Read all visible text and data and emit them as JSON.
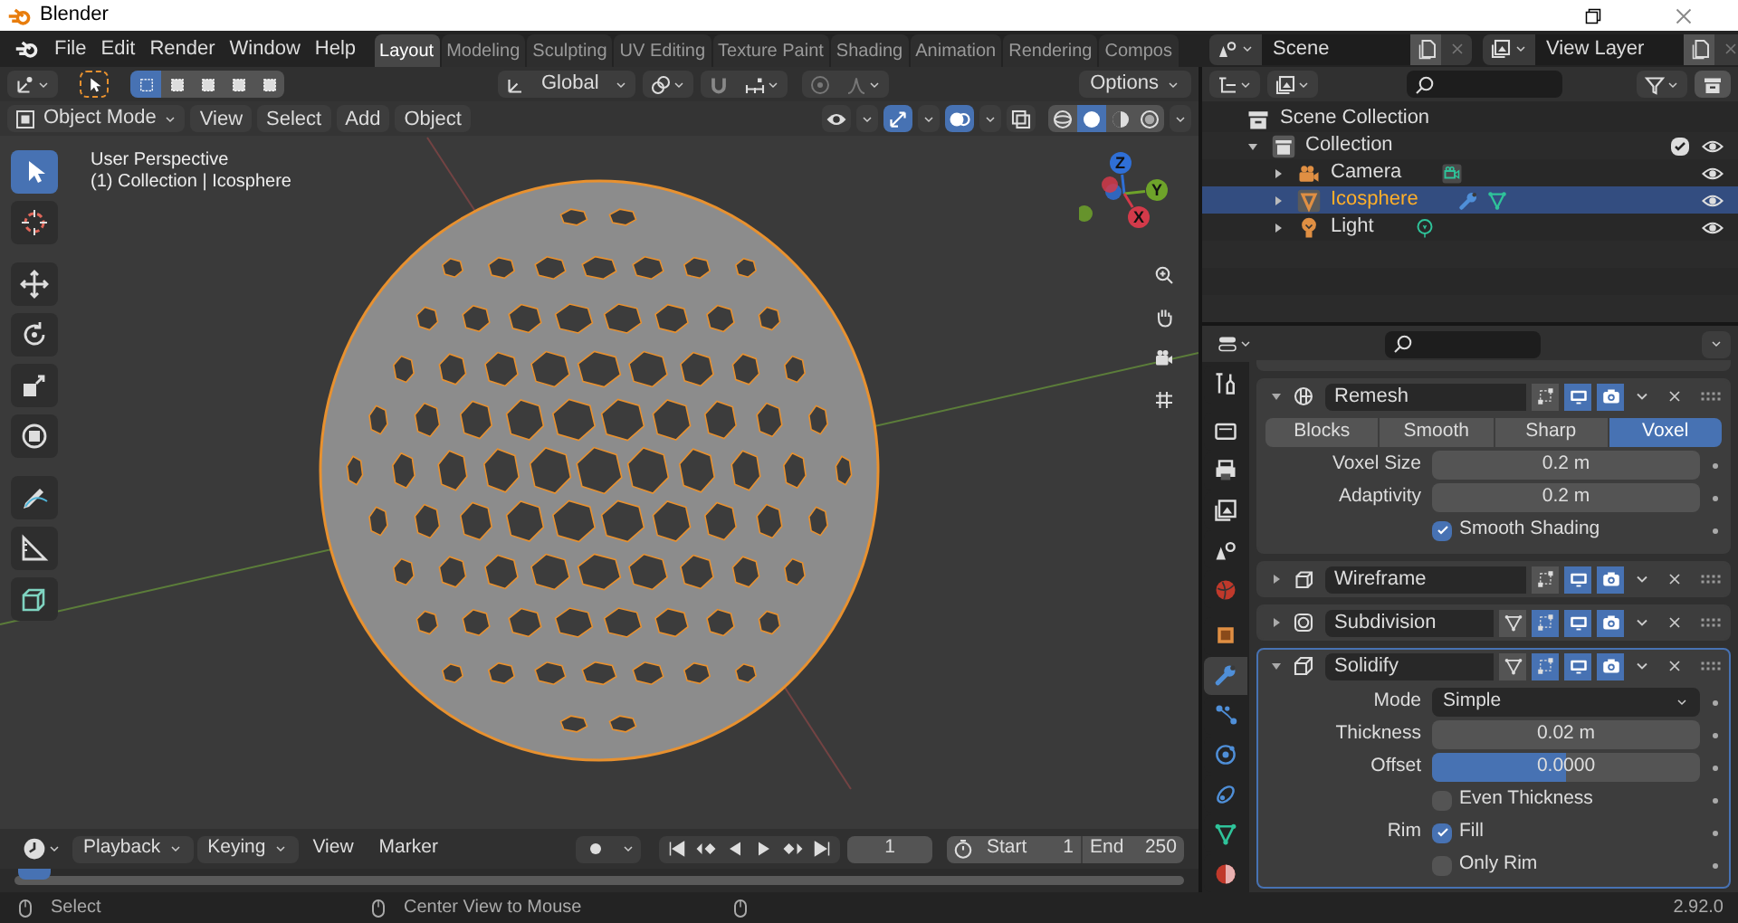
{
  "window": {
    "title": "Blender"
  },
  "menu": [
    "File",
    "Edit",
    "Render",
    "Window",
    "Help"
  ],
  "workspaces": [
    {
      "label": "Layout",
      "selected": true
    },
    {
      "label": "Modeling",
      "selected": false
    },
    {
      "label": "Sculpting",
      "selected": false
    },
    {
      "label": "UV Editing",
      "selected": false
    },
    {
      "label": "Texture Paint",
      "selected": false
    },
    {
      "label": "Shading",
      "selected": false
    },
    {
      "label": "Animation",
      "selected": false
    },
    {
      "label": "Rendering",
      "selected": false
    },
    {
      "label": "Compos",
      "selected": false
    }
  ],
  "scene": {
    "value": "Scene"
  },
  "view_layer": {
    "value": "View Layer"
  },
  "tool_header": {
    "select_modes": [
      {
        "selected": true
      },
      {
        "selected": false
      },
      {
        "selected": false
      },
      {
        "selected": false
      },
      {
        "selected": false
      }
    ],
    "orientation": "Global",
    "options": "Options"
  },
  "viewport_header": {
    "mode": "Object Mode",
    "menus": [
      "View",
      "Select",
      "Add",
      "Object"
    ],
    "toggles": [
      {
        "kind": "visibility",
        "on": false
      },
      {
        "kind": "gizmo",
        "on": true
      },
      {
        "kind": "overlay",
        "on": true
      },
      {
        "kind": "xray",
        "on": false
      }
    ],
    "shading": [
      {
        "kind": "wireframe",
        "selected": false
      },
      {
        "kind": "solid",
        "selected": true
      },
      {
        "kind": "material",
        "selected": false
      },
      {
        "kind": "rendered",
        "selected": false
      }
    ]
  },
  "viewport": {
    "perspective": "User Perspective",
    "context": "(1) Collection | Icosphere",
    "axes": [
      {
        "label": "Z",
        "color": "#2f6fd6"
      },
      {
        "label": "Y",
        "color": "#6ea32a"
      },
      {
        "label": "X",
        "color": "#d33a4a"
      }
    ]
  },
  "toolbar": [
    {
      "kind": "select",
      "selected": true
    },
    {
      "kind": "cursor",
      "selected": false
    },
    {
      "kind": "move",
      "selected": false
    },
    {
      "kind": "rotate",
      "selected": false
    },
    {
      "kind": "scale",
      "selected": false
    },
    {
      "kind": "transform",
      "selected": false
    },
    {
      "kind": "annotate",
      "selected": false
    },
    {
      "kind": "measure",
      "selected": false
    },
    {
      "kind": "add-cube",
      "selected": false
    }
  ],
  "outliner": {
    "items": [
      {
        "label": "Scene Collection",
        "kind": "scene-collection",
        "children": [
          {
            "label": "Collection",
            "kind": "collection",
            "expanded": true,
            "checked": true,
            "visible": true,
            "children": [
              {
                "label": "Camera",
                "kind": "camera",
                "expanded": false,
                "selected": false,
                "visible": true
              },
              {
                "label": "Icosphere",
                "kind": "mesh",
                "expanded": false,
                "selected": true,
                "visible": true
              },
              {
                "label": "Light",
                "kind": "light",
                "expanded": false,
                "selected": false,
                "visible": true
              }
            ]
          }
        ]
      }
    ]
  },
  "properties": {
    "tabs": [
      {
        "kind": "tool",
        "selected": false
      },
      {
        "kind": "render",
        "selected": false
      },
      {
        "kind": "output",
        "selected": false
      },
      {
        "kind": "view-layer",
        "selected": false
      },
      {
        "kind": "scene",
        "selected": false
      },
      {
        "kind": "world",
        "selected": false
      },
      {
        "kind": "object",
        "selected": false
      },
      {
        "kind": "modifier",
        "selected": true
      },
      {
        "kind": "particles",
        "selected": false
      },
      {
        "kind": "physics",
        "selected": false
      },
      {
        "kind": "constraints",
        "selected": false
      },
      {
        "kind": "data",
        "selected": false
      },
      {
        "kind": "material",
        "selected": false
      }
    ],
    "modifiers": [
      {
        "kind": "remesh",
        "name": "Remesh",
        "expanded": true,
        "active": false,
        "toggles": [
          {
            "kind": "editmode",
            "on": false
          },
          {
            "kind": "realtime",
            "on": true
          },
          {
            "kind": "render",
            "on": true
          }
        ],
        "rows": [
          {
            "kind": "segmented",
            "options": [
              {
                "label": "Blocks",
                "selected": false
              },
              {
                "label": "Smooth",
                "selected": false
              },
              {
                "label": "Sharp",
                "selected": false
              },
              {
                "label": "Voxel",
                "selected": true
              }
            ]
          },
          {
            "kind": "number",
            "label": "Voxel Size",
            "value": "0.2 m"
          },
          {
            "kind": "number",
            "label": "Adaptivity",
            "value": "0.2 m"
          },
          {
            "kind": "checkbox",
            "text": "Smooth Shading",
            "checked": true
          }
        ]
      },
      {
        "kind": "wireframe",
        "name": "Wireframe",
        "expanded": false,
        "active": false,
        "toggles": [
          {
            "kind": "editmode",
            "on": false
          },
          {
            "kind": "realtime",
            "on": true
          },
          {
            "kind": "render",
            "on": true
          }
        ]
      },
      {
        "kind": "subdivision",
        "name": "Subdivision",
        "expanded": false,
        "active": false,
        "toggles": [
          {
            "kind": "cage",
            "on": false
          },
          {
            "kind": "editmode",
            "on": true
          },
          {
            "kind": "realtime",
            "on": true
          },
          {
            "kind": "render",
            "on": true
          }
        ]
      },
      {
        "kind": "solidify",
        "name": "Solidify",
        "expanded": true,
        "active": true,
        "toggles": [
          {
            "kind": "cage",
            "on": false
          },
          {
            "kind": "editmode",
            "on": true
          },
          {
            "kind": "realtime",
            "on": true
          },
          {
            "kind": "render",
            "on": true
          }
        ],
        "rows": [
          {
            "kind": "dropdown",
            "label": "Mode",
            "value": "Simple"
          },
          {
            "kind": "number",
            "label": "Thickness",
            "value": "0.02 m"
          },
          {
            "kind": "slider",
            "label": "Offset",
            "value": "0.0000",
            "level": 0.5
          },
          {
            "kind": "checkbox",
            "text": "Even Thickness",
            "checked": false
          },
          {
            "kind": "checkbox",
            "label": "Rim",
            "text": "Fill",
            "checked": true
          },
          {
            "kind": "checkbox",
            "text": "Only Rim",
            "checked": false
          }
        ]
      }
    ]
  },
  "timeline": {
    "menus": [
      {
        "label": "Playback",
        "dropdown": true
      },
      {
        "label": "Keying",
        "dropdown": true
      },
      {
        "label": "View",
        "dropdown": false
      },
      {
        "label": "Marker",
        "dropdown": false
      }
    ],
    "current_frame": "1",
    "start_label": "Start",
    "start": "1",
    "end_label": "End",
    "end": "250"
  },
  "status_bar": {
    "items": [
      "Select",
      "Center View to Mouse"
    ],
    "version": "2.92.0"
  }
}
